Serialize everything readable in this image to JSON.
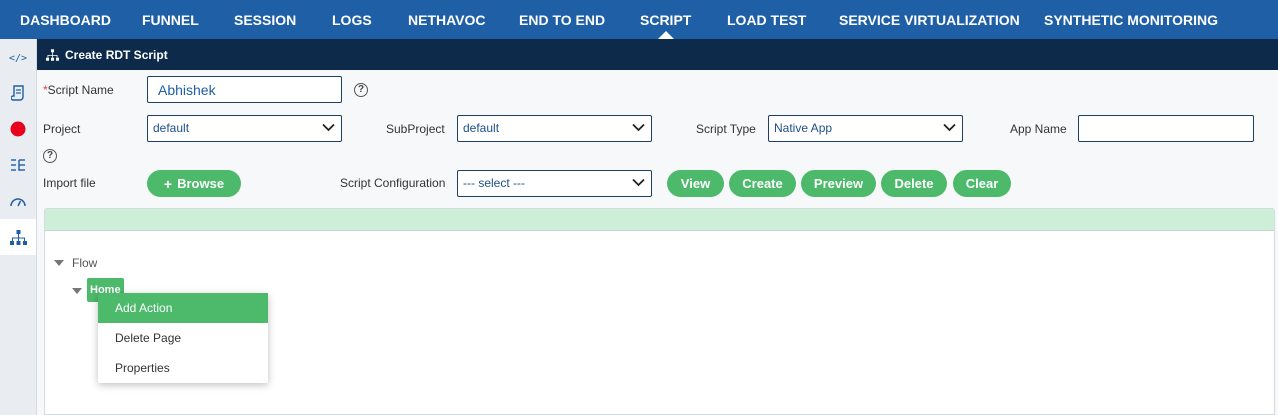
{
  "nav": {
    "items": [
      "DASHBOARD",
      "FUNNEL",
      "SESSION",
      "LOGS",
      "NETHAVOC",
      "END TO END",
      "SCRIPT",
      "LOAD TEST",
      "SERVICE VIRTUALIZATION",
      "SYNTHETIC MONITORING"
    ],
    "active": "SCRIPT"
  },
  "rail": {
    "icons": [
      "code-icon",
      "script-icon",
      "record-icon",
      "list-tree-icon",
      "gauge-icon",
      "sitemap-icon"
    ],
    "record_color": "#e8001c"
  },
  "title": "Create RDT Script",
  "form": {
    "script_name_label": "Script Name",
    "required_mark": "*",
    "script_name_value": "Abhishek",
    "project_label": "Project",
    "project_value": "default",
    "subproject_label": "SubProject",
    "subproject_value": "default",
    "script_type_label": "Script Type",
    "script_type_value": "Native App",
    "app_name_label": "App Name",
    "app_name_value": "",
    "help_glyph": "?",
    "import_label": "Import file",
    "browse_label": "Browse",
    "plus_glyph": "+",
    "config_label": "Script Configuration",
    "config_value": "--- select ---"
  },
  "actions": [
    "View",
    "Create",
    "Preview",
    "Delete",
    "Clear"
  ],
  "tree": {
    "root": "Flow",
    "node": "Home"
  },
  "context_menu": [
    "Add Action",
    "Delete Page",
    "Properties"
  ],
  "colors": {
    "nav_bg": "#1f5fa6",
    "title_bg": "#0d2a4a",
    "accent_green": "#4cb96b",
    "panel_head": "#cdeed7"
  }
}
